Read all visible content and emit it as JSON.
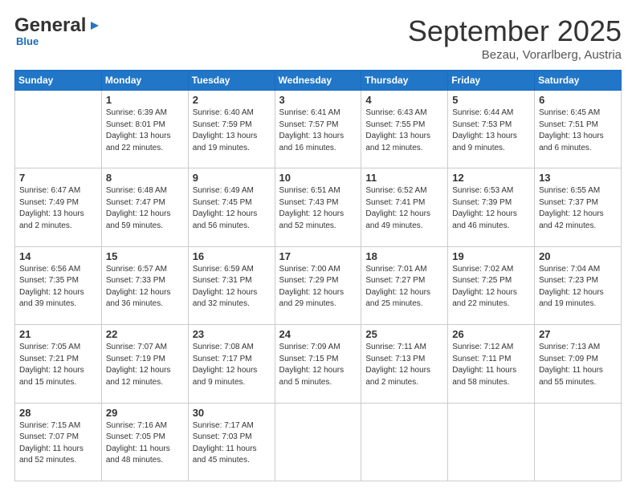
{
  "logo": {
    "general": "General",
    "blue": "Blue"
  },
  "header": {
    "month": "September 2025",
    "location": "Bezau, Vorarlberg, Austria"
  },
  "weekdays": [
    "Sunday",
    "Monday",
    "Tuesday",
    "Wednesday",
    "Thursday",
    "Friday",
    "Saturday"
  ],
  "weeks": [
    [
      {
        "day": "",
        "info": ""
      },
      {
        "day": "1",
        "info": "Sunrise: 6:39 AM\nSunset: 8:01 PM\nDaylight: 13 hours\nand 22 minutes."
      },
      {
        "day": "2",
        "info": "Sunrise: 6:40 AM\nSunset: 7:59 PM\nDaylight: 13 hours\nand 19 minutes."
      },
      {
        "day": "3",
        "info": "Sunrise: 6:41 AM\nSunset: 7:57 PM\nDaylight: 13 hours\nand 16 minutes."
      },
      {
        "day": "4",
        "info": "Sunrise: 6:43 AM\nSunset: 7:55 PM\nDaylight: 13 hours\nand 12 minutes."
      },
      {
        "day": "5",
        "info": "Sunrise: 6:44 AM\nSunset: 7:53 PM\nDaylight: 13 hours\nand 9 minutes."
      },
      {
        "day": "6",
        "info": "Sunrise: 6:45 AM\nSunset: 7:51 PM\nDaylight: 13 hours\nand 6 minutes."
      }
    ],
    [
      {
        "day": "7",
        "info": "Sunrise: 6:47 AM\nSunset: 7:49 PM\nDaylight: 13 hours\nand 2 minutes."
      },
      {
        "day": "8",
        "info": "Sunrise: 6:48 AM\nSunset: 7:47 PM\nDaylight: 12 hours\nand 59 minutes."
      },
      {
        "day": "9",
        "info": "Sunrise: 6:49 AM\nSunset: 7:45 PM\nDaylight: 12 hours\nand 56 minutes."
      },
      {
        "day": "10",
        "info": "Sunrise: 6:51 AM\nSunset: 7:43 PM\nDaylight: 12 hours\nand 52 minutes."
      },
      {
        "day": "11",
        "info": "Sunrise: 6:52 AM\nSunset: 7:41 PM\nDaylight: 12 hours\nand 49 minutes."
      },
      {
        "day": "12",
        "info": "Sunrise: 6:53 AM\nSunset: 7:39 PM\nDaylight: 12 hours\nand 46 minutes."
      },
      {
        "day": "13",
        "info": "Sunrise: 6:55 AM\nSunset: 7:37 PM\nDaylight: 12 hours\nand 42 minutes."
      }
    ],
    [
      {
        "day": "14",
        "info": "Sunrise: 6:56 AM\nSunset: 7:35 PM\nDaylight: 12 hours\nand 39 minutes."
      },
      {
        "day": "15",
        "info": "Sunrise: 6:57 AM\nSunset: 7:33 PM\nDaylight: 12 hours\nand 36 minutes."
      },
      {
        "day": "16",
        "info": "Sunrise: 6:59 AM\nSunset: 7:31 PM\nDaylight: 12 hours\nand 32 minutes."
      },
      {
        "day": "17",
        "info": "Sunrise: 7:00 AM\nSunset: 7:29 PM\nDaylight: 12 hours\nand 29 minutes."
      },
      {
        "day": "18",
        "info": "Sunrise: 7:01 AM\nSunset: 7:27 PM\nDaylight: 12 hours\nand 25 minutes."
      },
      {
        "day": "19",
        "info": "Sunrise: 7:02 AM\nSunset: 7:25 PM\nDaylight: 12 hours\nand 22 minutes."
      },
      {
        "day": "20",
        "info": "Sunrise: 7:04 AM\nSunset: 7:23 PM\nDaylight: 12 hours\nand 19 minutes."
      }
    ],
    [
      {
        "day": "21",
        "info": "Sunrise: 7:05 AM\nSunset: 7:21 PM\nDaylight: 12 hours\nand 15 minutes."
      },
      {
        "day": "22",
        "info": "Sunrise: 7:07 AM\nSunset: 7:19 PM\nDaylight: 12 hours\nand 12 minutes."
      },
      {
        "day": "23",
        "info": "Sunrise: 7:08 AM\nSunset: 7:17 PM\nDaylight: 12 hours\nand 9 minutes."
      },
      {
        "day": "24",
        "info": "Sunrise: 7:09 AM\nSunset: 7:15 PM\nDaylight: 12 hours\nand 5 minutes."
      },
      {
        "day": "25",
        "info": "Sunrise: 7:11 AM\nSunset: 7:13 PM\nDaylight: 12 hours\nand 2 minutes."
      },
      {
        "day": "26",
        "info": "Sunrise: 7:12 AM\nSunset: 7:11 PM\nDaylight: 11 hours\nand 58 minutes."
      },
      {
        "day": "27",
        "info": "Sunrise: 7:13 AM\nSunset: 7:09 PM\nDaylight: 11 hours\nand 55 minutes."
      }
    ],
    [
      {
        "day": "28",
        "info": "Sunrise: 7:15 AM\nSunset: 7:07 PM\nDaylight: 11 hours\nand 52 minutes."
      },
      {
        "day": "29",
        "info": "Sunrise: 7:16 AM\nSunset: 7:05 PM\nDaylight: 11 hours\nand 48 minutes."
      },
      {
        "day": "30",
        "info": "Sunrise: 7:17 AM\nSunset: 7:03 PM\nDaylight: 11 hours\nand 45 minutes."
      },
      {
        "day": "",
        "info": ""
      },
      {
        "day": "",
        "info": ""
      },
      {
        "day": "",
        "info": ""
      },
      {
        "day": "",
        "info": ""
      }
    ]
  ]
}
